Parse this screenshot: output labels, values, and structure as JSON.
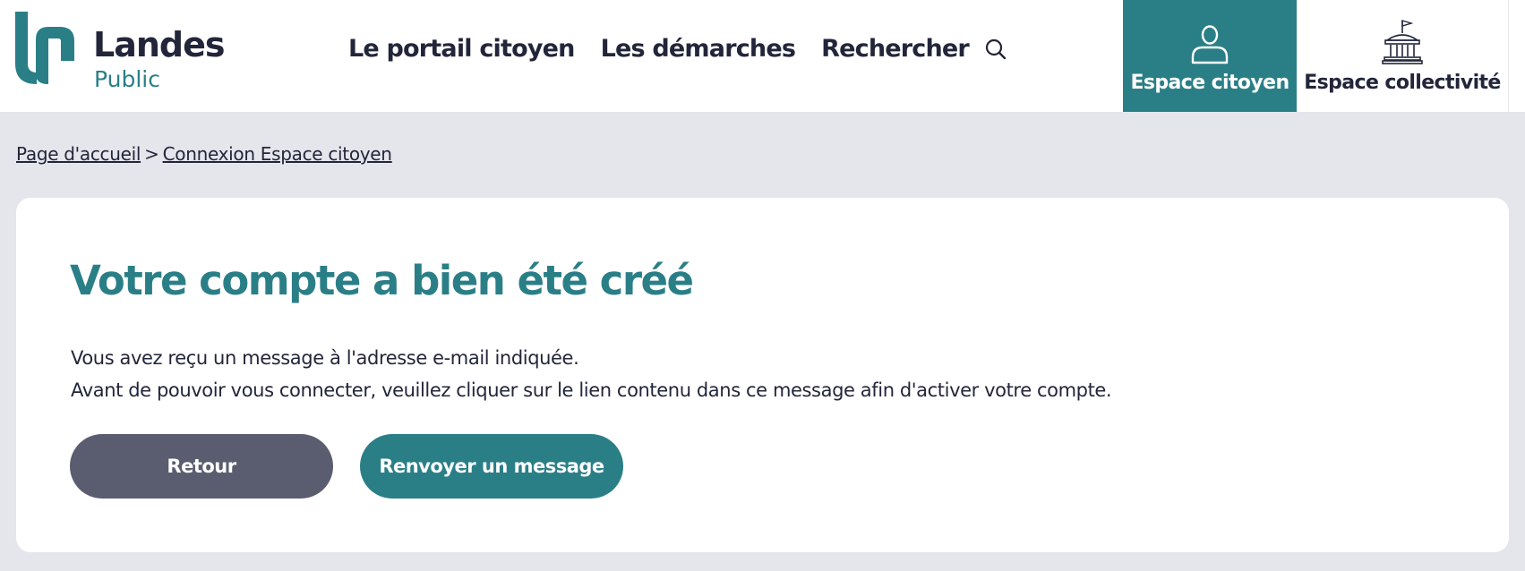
{
  "header": {
    "logo": {
      "name": "Landes",
      "sub": "Public"
    },
    "nav": [
      {
        "label": "Le portail citoyen"
      },
      {
        "label": "Les démarches"
      },
      {
        "label": "Rechercher"
      }
    ],
    "spaces": {
      "citoyen": "Espace citoyen",
      "collectivite": "Espace collectivité"
    }
  },
  "breadcrumb": {
    "home": "Page d'accueil",
    "separator": ">",
    "current": "Connexion Espace citoyen"
  },
  "card": {
    "title": "Votre compte a bien été créé",
    "line1": "Vous avez reçu un message à l'adresse e-mail indiquée.",
    "line2": "Avant de pouvoir vous connecter, veuillez cliquer sur le lien contenu dans ce message afin d'activer votre compte.",
    "back_label": "Retour",
    "resend_label": "Renvoyer un message"
  },
  "colors": {
    "accent": "#2a7f87",
    "dark": "#23263a",
    "secondary_button": "#5a5d70",
    "page_background": "#e4e6ec"
  },
  "icons": [
    "search-icon",
    "user-icon",
    "town-hall-icon"
  ]
}
